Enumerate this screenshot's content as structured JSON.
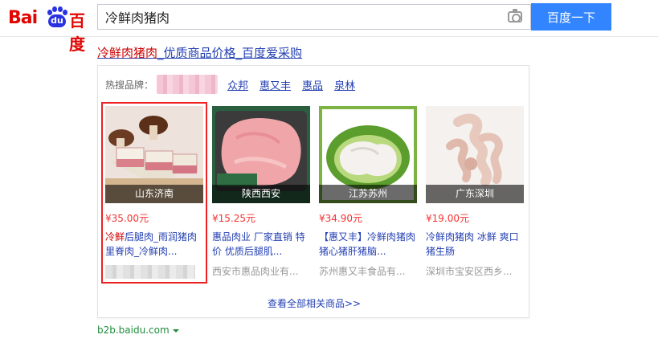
{
  "header": {
    "logo_text_left": "Bai",
    "logo_paw_text": "du",
    "logo_text_right": "百度",
    "search_value": "冷鲜肉猪肉",
    "search_button_label": "百度一下"
  },
  "result": {
    "title_keyword": "冷鲜肉猪肉",
    "title_rest": "_优质商品价格_百度爱采购"
  },
  "brands": {
    "label": "热搜品牌：",
    "items": [
      "众邦",
      "惠又丰",
      "惠品",
      "泉林"
    ]
  },
  "products": [
    {
      "region": "山东济南",
      "price": "¥35.00元",
      "name_keyword": "冷鲜",
      "name_rest": "后腿肉_雨润猪肉里脊肉_冷鲜肉..."
    },
    {
      "region": "陕西西安",
      "price": "¥15.25元",
      "name_keyword": "",
      "name_rest": "惠品肉业 厂家直销 特价 优质后腿肌...",
      "seller": "西安市惠品肉业有..."
    },
    {
      "region": "江苏苏州",
      "price": "¥34.90元",
      "name_keyword": "",
      "name_rest": "【惠又丰】冷鲜肉猪肉猪心猪肝猪脑...",
      "seller": "苏州惠又丰食品有..."
    },
    {
      "region": "广东深圳",
      "price": "¥19.00元",
      "name_keyword": "",
      "name_rest": "冷鲜肉猪肉 冰鲜 爽口 猪生肠",
      "seller": "深圳市宝安区西乡..."
    }
  ],
  "more_link": "查看全部相关商品>>",
  "source_url": "b2b.baidu.com",
  "colors": {
    "accent_blue": "#3385ff",
    "link": "#2440b3",
    "highlight_red": "#c00",
    "price_red": "#f73131",
    "selection_outline": "#e22",
    "url_green": "#1f8c3b"
  }
}
